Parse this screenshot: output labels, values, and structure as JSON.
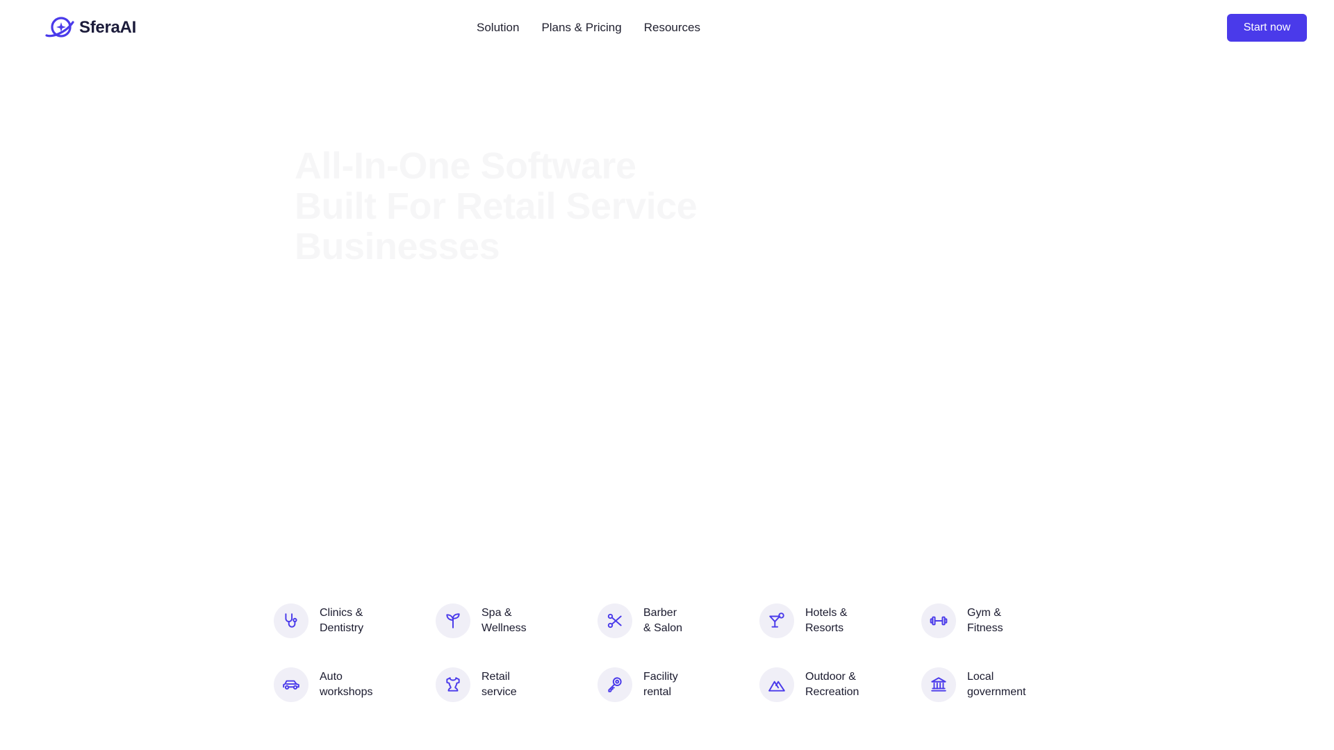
{
  "header": {
    "brand": "SferaAI",
    "nav": [
      {
        "label": "Solution"
      },
      {
        "label": "Plans & Pricing"
      },
      {
        "label": "Resources"
      }
    ],
    "cta_label": "Start now"
  },
  "hero": {
    "title_lines": [
      "All-In-One Software",
      "Built For Retail Service",
      "Businesses"
    ]
  },
  "industries": [
    {
      "line1": "Clinics &",
      "line2": "Dentistry",
      "icon": "stethoscope-icon"
    },
    {
      "line1": "Spa &",
      "line2": "Wellness",
      "icon": "sprout-icon"
    },
    {
      "line1": "Barber",
      "line2": "& Salon",
      "icon": "scissors-icon"
    },
    {
      "line1": "Hotels &",
      "line2": "Resorts",
      "icon": "cocktail-icon"
    },
    {
      "line1": "Gym &",
      "line2": "Fitness",
      "icon": "dumbbell-icon"
    },
    {
      "line1": "Auto",
      "line2": "workshops",
      "icon": "car-icon"
    },
    {
      "line1": "Retail",
      "line2": "service",
      "icon": "shirt-icon"
    },
    {
      "line1": "Facility",
      "line2": "rental",
      "icon": "key-icon"
    },
    {
      "line1": "Outdoor &",
      "line2": "Recreation",
      "icon": "mountain-icon"
    },
    {
      "line1": "Local",
      "line2": "government",
      "icon": "government-building-icon"
    }
  ],
  "colors": {
    "accent": "#4a3aea",
    "icon_bg": "#f0eff7",
    "text": "#1a1a2e"
  }
}
